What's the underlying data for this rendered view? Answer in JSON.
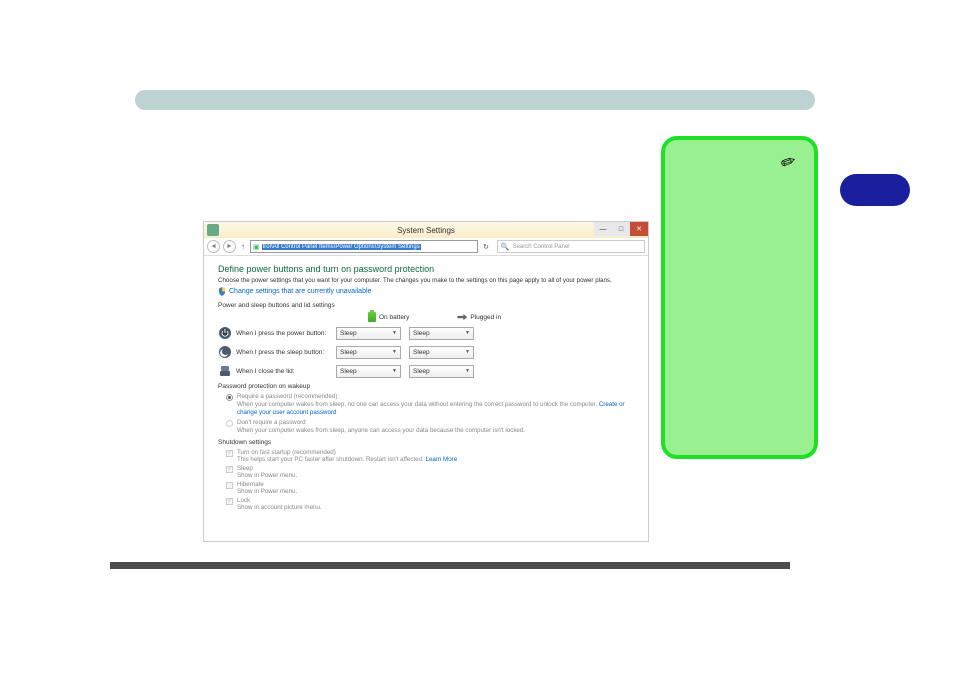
{
  "window": {
    "title": "System Settings",
    "address_prefix": "↑",
    "address_path": "trol\\All Control Panel Items\\Power Options\\System Settings",
    "search_placeholder": "Search Control Panel"
  },
  "content": {
    "heading": "Define power buttons and turn on password protection",
    "desc": "Choose the power settings that you want for your computer. The changes you make to the settings on this page apply to all of your power plans.",
    "change_link": "Change settings that are currently unavailable",
    "buttons_section": "Power and sleep buttons and lid settings",
    "col_battery": "On battery",
    "col_plugged": "Plugged in",
    "rows": [
      {
        "label": "When I press the power button:",
        "battery": "Sleep",
        "plugged": "Sleep"
      },
      {
        "label": "When I press the sleep button:",
        "battery": "Sleep",
        "plugged": "Sleep"
      },
      {
        "label": "When I close the lid:",
        "battery": "Sleep",
        "plugged": "Sleep"
      }
    ],
    "password_section": "Password protection on wakeup",
    "radio1_label": "Require a password (recommended)",
    "radio1_desc_a": "When your computer wakes from sleep, no one can access your data without entering the correct password to unlock the computer. ",
    "radio1_link": "Create or change your user account password",
    "radio2_label": "Don't require a password",
    "radio2_desc": "When your computer wakes from sleep, anyone can access your data because the computer isn't locked.",
    "shutdown_section": "Shutdown settings",
    "check1_label": "Turn on fast startup (recommended)",
    "check1_desc_a": "This helps start your PC faster after shutdown. Restart isn't affected. ",
    "check1_link": "Learn More",
    "check2_label": "Sleep",
    "check2_desc": "Show in Power menu.",
    "check3_label": "Hibernate",
    "check3_desc": "Show in Power menu.",
    "check4_label": "Lock",
    "check4_desc": "Show in account picture menu."
  }
}
